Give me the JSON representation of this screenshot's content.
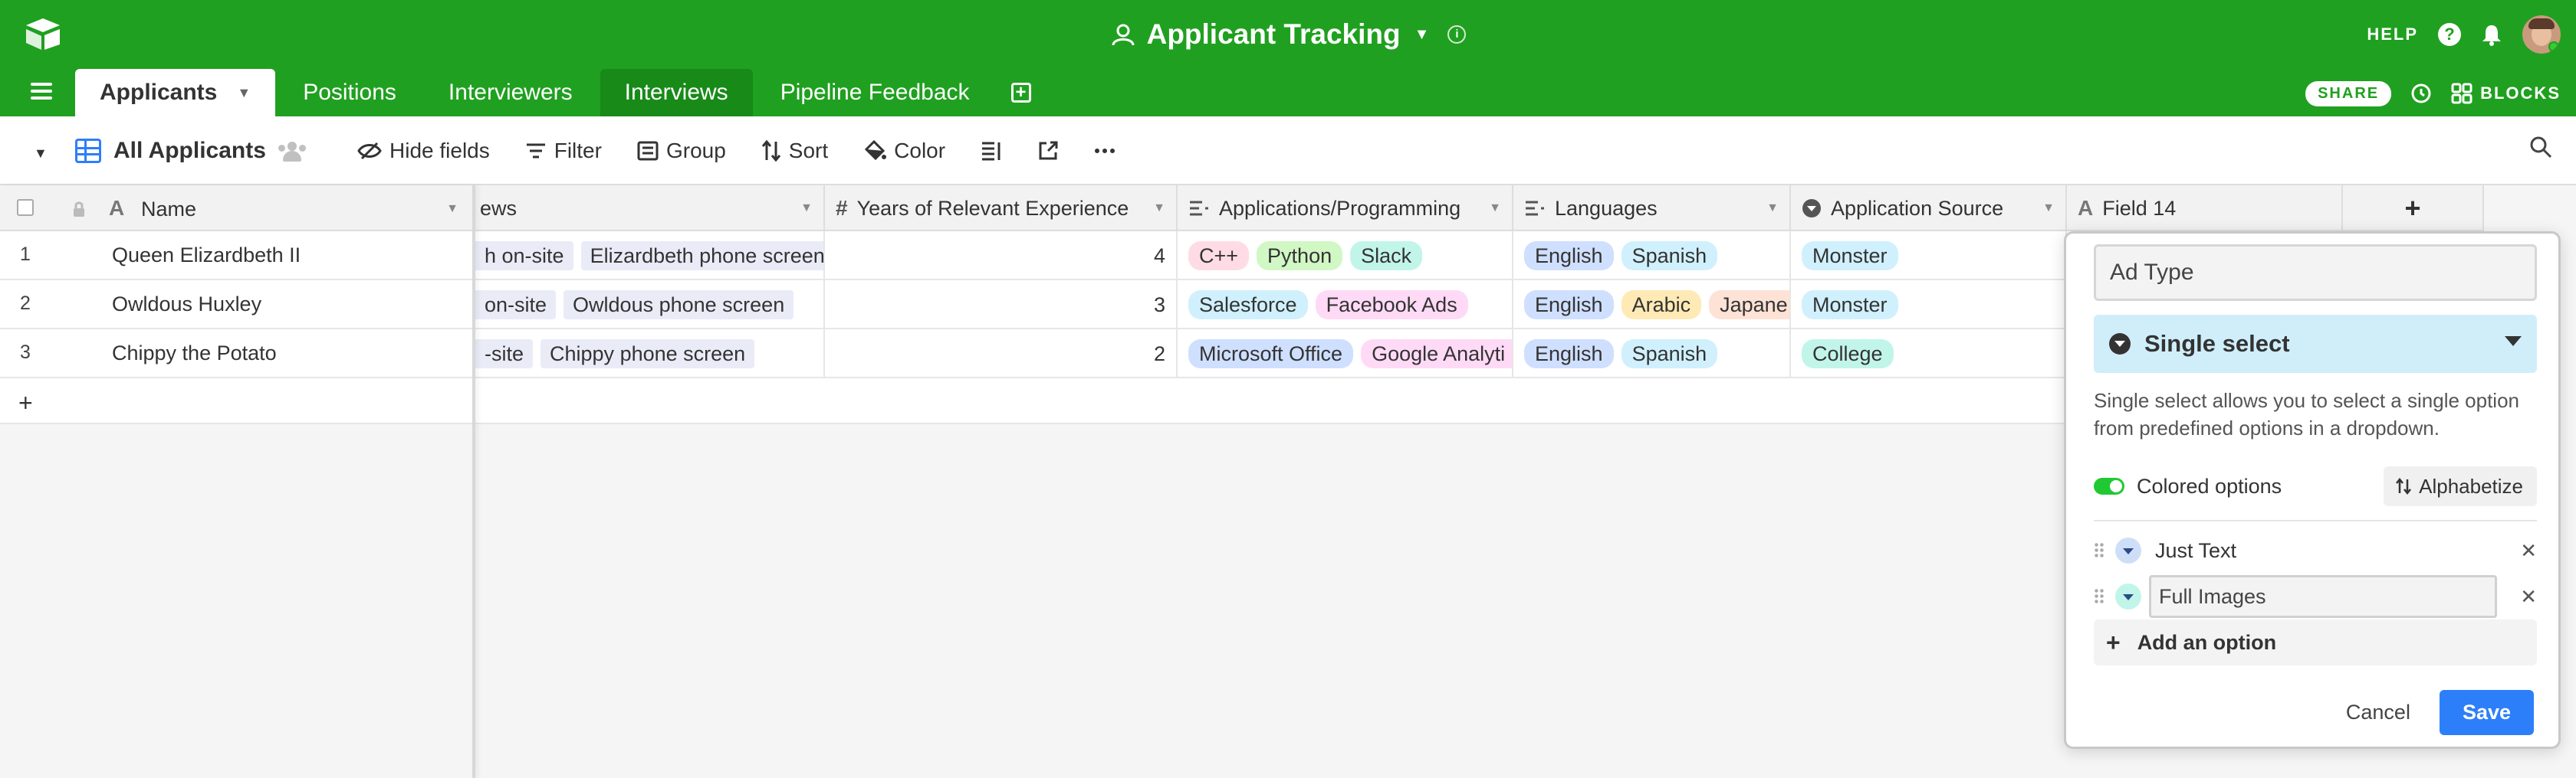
{
  "header": {
    "base_title": "Applicant Tracking",
    "help_label": "HELP"
  },
  "tabs": [
    {
      "label": "Applicants"
    },
    {
      "label": "Positions"
    },
    {
      "label": "Interviewers"
    },
    {
      "label": "Interviews"
    },
    {
      "label": "Pipeline Feedback"
    }
  ],
  "tab_bar": {
    "share_label": "SHARE",
    "blocks_label": "BLOCKS"
  },
  "view": {
    "name": "All Applicants"
  },
  "toolbar": {
    "hide_fields": "Hide fields",
    "filter": "Filter",
    "group": "Group",
    "sort": "Sort",
    "color": "Color"
  },
  "columns": {
    "name": "Name",
    "interviews": "ews",
    "years": "Years of Relevant Experience",
    "apps": "Applications/Programming",
    "languages": "Languages",
    "source": "Application Source",
    "field14": "Field 14"
  },
  "rows": [
    {
      "num": "1",
      "name": "Queen Elizardbeth II",
      "interviews": [
        "h on-site",
        "Elizardbeth phone screen"
      ],
      "years": "4",
      "apps": [
        "C++",
        "Python",
        "Slack"
      ],
      "languages": [
        "English",
        "Spanish"
      ],
      "source": "Monster"
    },
    {
      "num": "2",
      "name": "Owldous Huxley",
      "interviews": [
        "on-site",
        "Owldous phone screen"
      ],
      "years": "3",
      "apps": [
        "Salesforce",
        "Facebook Ads"
      ],
      "languages": [
        "English",
        "Arabic",
        "Japane"
      ],
      "source": "Monster"
    },
    {
      "num": "3",
      "name": "Chippy the Potato",
      "interviews": [
        "-site",
        "Chippy phone screen"
      ],
      "years": "2",
      "apps": [
        "Microsoft Office",
        "Google Analyti"
      ],
      "languages": [
        "English",
        "Spanish"
      ],
      "source": "College"
    }
  ],
  "pill_colors": {
    "C++": "#ffdce5",
    "Python": "#d1f7c4",
    "Slack": "#c2f5e9",
    "Salesforce": "#d0f0fd",
    "Facebook Ads": "#ffdaf6",
    "Microsoft Office": "#cfdfff",
    "Google Analyti": "#ffdaf6",
    "English": "#cfdfff",
    "Spanish": "#d0f0fd",
    "Arabic": "#ffeab6",
    "Japane": "#fee2d5",
    "Monster": "#d0f0fd",
    "College": "#c2f5e9"
  },
  "field_panel": {
    "field_name": "Ad Type",
    "type_label": "Single select",
    "description": "Single select allows you to select a single option from predefined options in a dropdown.",
    "colored_options_label": "Colored options",
    "alphabetize_label": "Alphabetize",
    "options": [
      "Just Text",
      "Full Images"
    ],
    "add_option_label": "Add an option",
    "cancel_label": "Cancel",
    "save_label": "Save"
  },
  "accent": "#2d7ff9",
  "brand_green": "#20a020"
}
